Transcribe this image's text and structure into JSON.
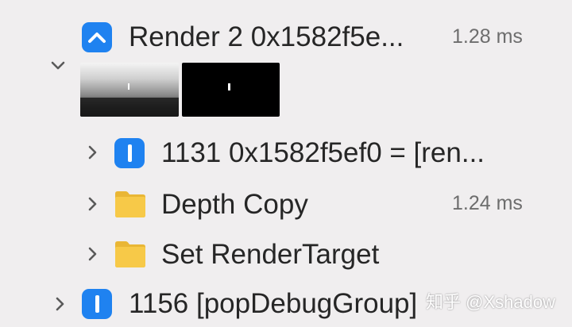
{
  "tree": {
    "render_pass": {
      "label": "Render 2 0x1582f5e...",
      "time": "1.28 ms",
      "icon": "render-encoder-icon"
    },
    "children": [
      {
        "label": "1131 0x1582f5ef0 = [ren...",
        "time": "",
        "icon": "command-icon"
      },
      {
        "label": "Depth Copy",
        "time": "1.24 ms",
        "icon": "folder-icon"
      },
      {
        "label": "Set RenderTarget",
        "time": "",
        "icon": "folder-icon"
      }
    ],
    "sibling": {
      "label": "1156 [popDebugGroup]",
      "icon": "command-icon"
    }
  },
  "thumbnails": [
    {
      "name": "depth-attachment-thumbnail"
    },
    {
      "name": "color-attachment-thumbnail"
    }
  ],
  "colors": {
    "background": "#f0eeef",
    "badge_blue": "#1f82f0",
    "folder_yellow": "#f7c948",
    "time_gray": "#6d6d6d"
  },
  "watermark": "知乎 @Xshadow"
}
